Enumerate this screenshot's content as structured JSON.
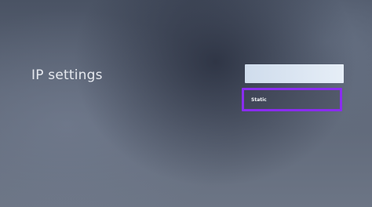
{
  "screen": {
    "title": "IP settings"
  },
  "menu": {
    "options": [
      {
        "label": ""
      },
      {
        "label": "Static"
      }
    ],
    "focus_color": "#8a2cf0"
  }
}
